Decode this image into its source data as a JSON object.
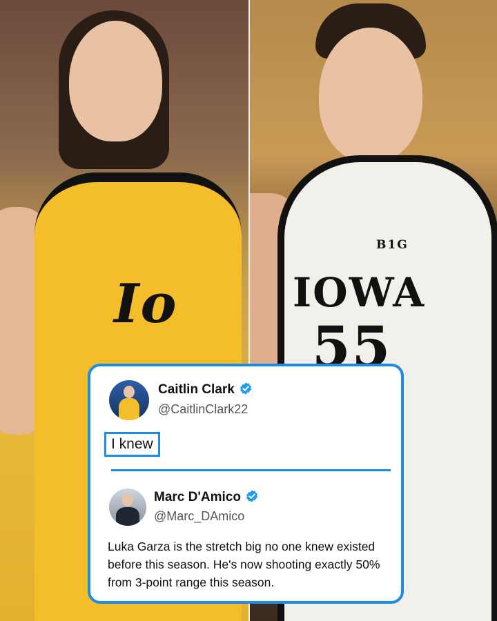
{
  "left_player": {
    "jersey_text": "Io"
  },
  "right_player": {
    "jersey_text": "IOWA",
    "number": "55",
    "conference_logo": "B1G"
  },
  "card": {
    "accent": "#1d8be8",
    "tweet": {
      "author_name": "Caitlin Clark",
      "author_handle": "@CaitlinClark22",
      "verified_icon": "verified-badge-icon",
      "text": "I knew"
    },
    "quoted": {
      "author_name": "Marc D'Amico",
      "author_handle": "@Marc_DAmico",
      "verified_icon": "verified-badge-icon",
      "text": "Luka Garza is the stretch big no one knew existed before this season. He's now shooting exactly 50% from 3-point range this season."
    }
  }
}
